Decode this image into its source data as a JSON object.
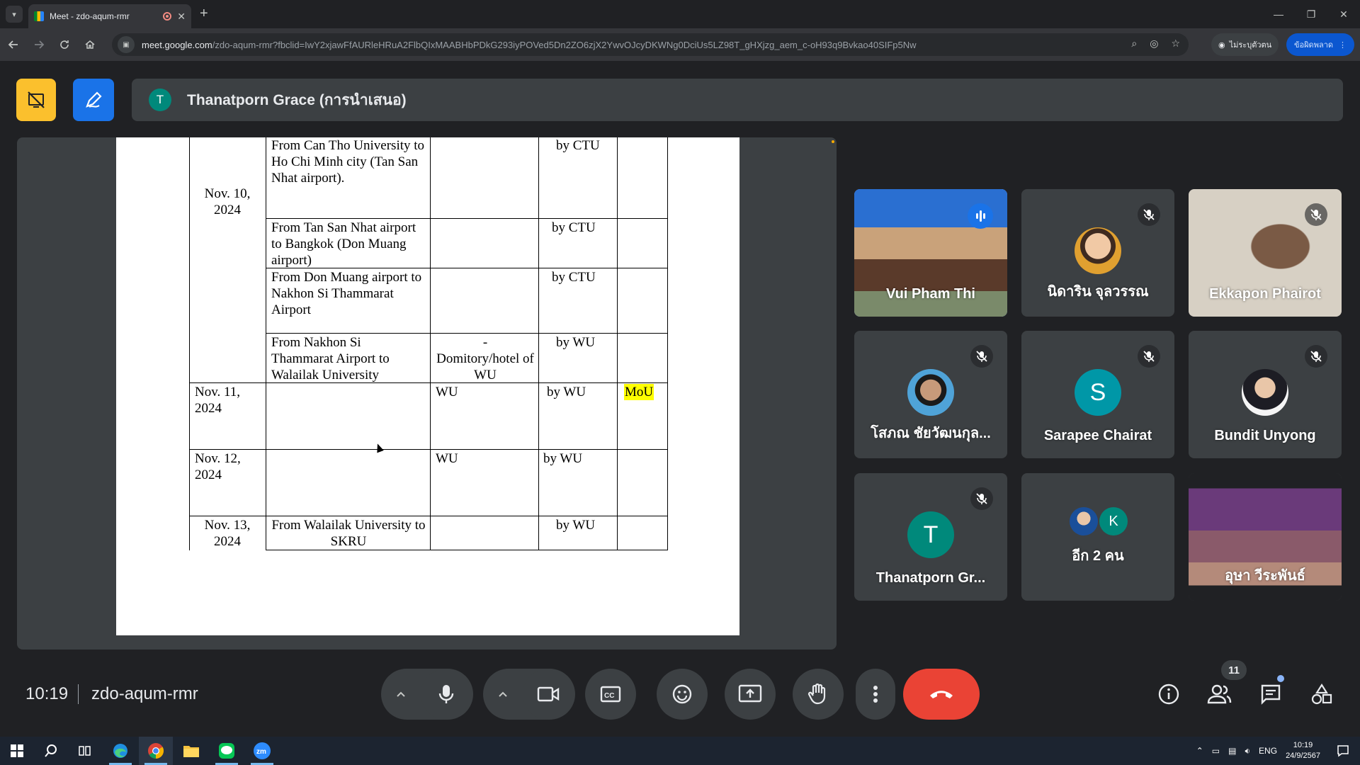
{
  "browser": {
    "tab_title": "Meet - zdo-aqum-rmr",
    "url_host": "meet.google.com",
    "url_path": "/zdo-aqum-rmr?fbclid=IwY2xjawFfAURleHRuA2FlbQIxMAABHbPDkG293iyPOVed5Dn2ZO6zjX2YwvOJcyDKWNg0DciUs5LZ98T_gHXjzg_aem_c-oH93q9Bvkao40SIFp5Nw",
    "guest_label": "ไม่ระบุตัวตน",
    "error_label": "ข้อผิดพลาด"
  },
  "meet": {
    "presenter_initial": "T",
    "presenter_label": "Thanatporn Grace (การนำเสนอ)",
    "time": "10:19",
    "meeting_code": "zdo-aqum-rmr",
    "people_count": "11"
  },
  "document": {
    "rows": [
      {
        "date": "Nov. 10,\n2024",
        "route": "From Can Tho University to Ho Chi Minh city (Tan San Nhat airport).",
        "accom": "",
        "transport": "by CTU",
        "note": ""
      },
      {
        "date": "",
        "route": "From Tan San Nhat airport to Bangkok (Don Muang airport)",
        "accom": "",
        "transport": "by CTU",
        "note": ""
      },
      {
        "date": "",
        "route": "From Don Muang airport to Nakhon Si Thammarat Airport",
        "accom": "",
        "transport": "by CTU",
        "note": ""
      },
      {
        "date": "",
        "route": "From Nakhon Si Thammarat Airport to Walailak University",
        "accom": "-\nDomitory/hotel of WU",
        "transport": "by WU",
        "note": ""
      },
      {
        "date": "Nov. 11,\n2024",
        "route": "",
        "accom": "WU",
        "transport": "by WU",
        "note": "MoU"
      },
      {
        "date": "Nov. 12,\n2024",
        "route": "",
        "accom": "WU",
        "transport": "by WU",
        "note": ""
      },
      {
        "date": "Nov. 13,\n2024",
        "route": "From Walailak University to SKRU",
        "accom": "",
        "transport": "by WU",
        "note": ""
      }
    ]
  },
  "participants": [
    {
      "name": "Vui Pham Thi",
      "kind": "video",
      "state": "speaking"
    },
    {
      "name": "นิดาริน จุลวรรณ",
      "kind": "photo",
      "state": "muted"
    },
    {
      "name": "Ekkapon Phairot",
      "kind": "video",
      "state": "muted"
    },
    {
      "name": "โสภณ ชัยวัฒนกุล...",
      "kind": "photo",
      "state": "muted"
    },
    {
      "name": "Sarapee Chairat",
      "kind": "initial",
      "initial": "S",
      "color": "#0097a7",
      "state": "muted"
    },
    {
      "name": "Bundit Unyong",
      "kind": "photo",
      "state": "muted"
    },
    {
      "name": "Thanatporn Gr...",
      "kind": "initial",
      "initial": "T",
      "color": "#00897b",
      "state": "muted"
    },
    {
      "name": "อีก 2 คน",
      "kind": "others",
      "initial": "K",
      "state": "none"
    },
    {
      "name": "อุษา วีระพันธ์",
      "kind": "video",
      "state": "none"
    }
  ],
  "taskbar": {
    "lang": "ENG",
    "clock_time": "10:19",
    "clock_date": "24/9/2567"
  },
  "colors": {
    "bg": "#202124",
    "tile": "#3c4043",
    "accent": "#1a73e8",
    "end_call": "#ea4335",
    "present_btn": "#fbc02d",
    "highlight": "#ffff00"
  }
}
